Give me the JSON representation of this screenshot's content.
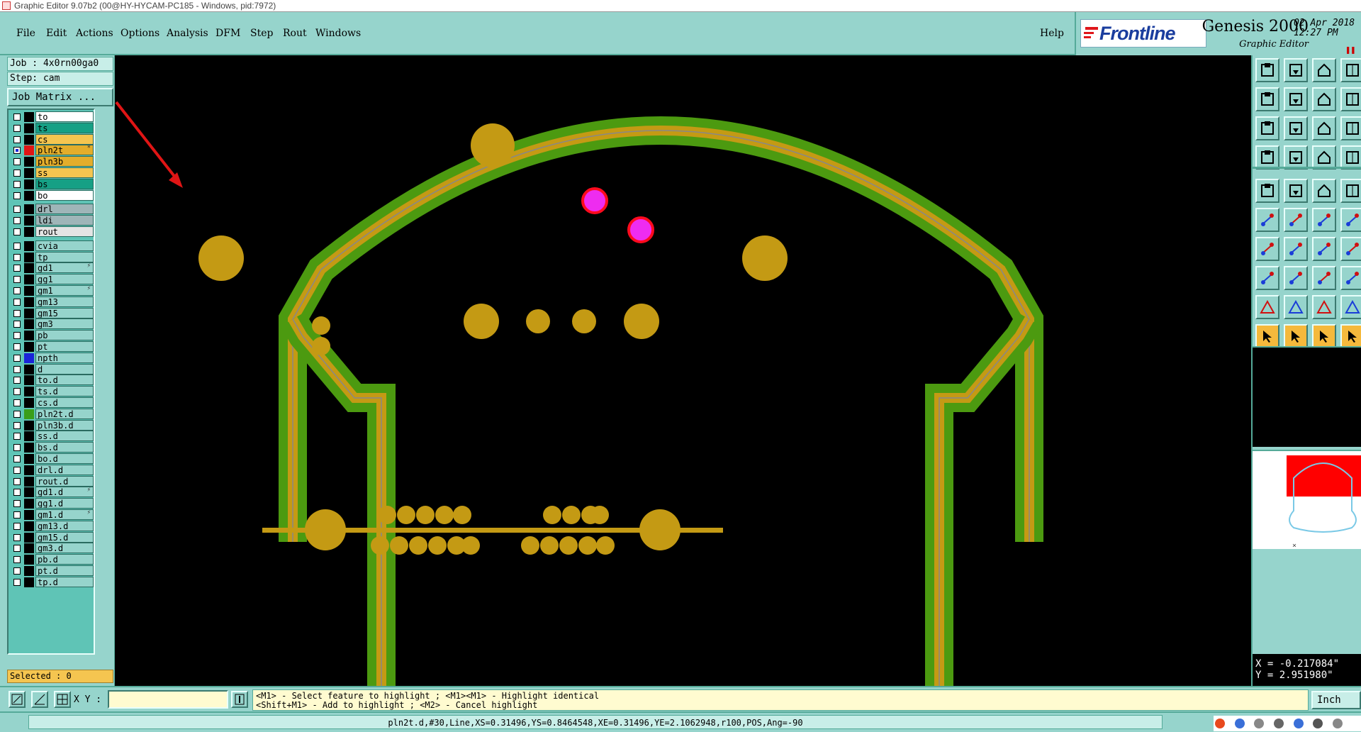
{
  "window": {
    "title": "Graphic Editor 9.07b2 (00@HY-HYCAM-PC185 - Windows, pid:7972)"
  },
  "menu": {
    "items": [
      "File",
      "Edit",
      "Actions",
      "Options",
      "Analysis",
      "DFM",
      "Step",
      "Rout",
      "Windows"
    ],
    "help": "Help"
  },
  "brand": {
    "logo": "Frontline",
    "product": "Genesis 2000",
    "subtitle": "Graphic Editor",
    "date": "02 Apr 2018",
    "time": "12:27 PM"
  },
  "job": {
    "job_label": "Job : 4x0rn00ga0",
    "step_label": "Step: cam",
    "matrix_button": "Job Matrix ..."
  },
  "layers": [
    {
      "name": "to",
      "bg": "#ffffff",
      "swatch": "#000000"
    },
    {
      "name": "ts",
      "bg": "#16a085",
      "swatch": "#000000"
    },
    {
      "name": "cs",
      "bg": "#f5c550",
      "swatch": "#000000"
    },
    {
      "name": "pln2t",
      "bg": "#e3ad2b",
      "swatch": "#e01515",
      "checked": true,
      "mark": "*"
    },
    {
      "name": "pln3b",
      "bg": "#e3ad2b",
      "swatch": "#000000"
    },
    {
      "name": "ss",
      "bg": "#f5c550",
      "swatch": "#000000"
    },
    {
      "name": "bs",
      "bg": "#16a085",
      "swatch": "#000000"
    },
    {
      "name": "bo",
      "bg": "#ffffff",
      "swatch": "#000000"
    },
    {
      "name": "drl",
      "bg": "#9fb5b8",
      "swatch": "#000000",
      "gap": true
    },
    {
      "name": "ldi",
      "bg": "#9fb5b8",
      "swatch": "#000000"
    },
    {
      "name": "rout",
      "bg": "#e4e4e4",
      "swatch": "#000000"
    },
    {
      "name": "cvia",
      "bg": "#96d4cc",
      "swatch": "#000000",
      "gap": true
    },
    {
      "name": "tp",
      "bg": "#96d4cc",
      "swatch": "#000000"
    },
    {
      "name": "gd1",
      "bg": "#96d4cc",
      "swatch": "#000000",
      "mark": "⚡"
    },
    {
      "name": "gg1",
      "bg": "#96d4cc",
      "swatch": "#000000"
    },
    {
      "name": "gm1",
      "bg": "#96d4cc",
      "swatch": "#000000",
      "mark": "⚡"
    },
    {
      "name": "gm13",
      "bg": "#96d4cc",
      "swatch": "#000000"
    },
    {
      "name": "gm15",
      "bg": "#96d4cc",
      "swatch": "#000000"
    },
    {
      "name": "gm3",
      "bg": "#96d4cc",
      "swatch": "#000000"
    },
    {
      "name": "pb",
      "bg": "#96d4cc",
      "swatch": "#000000"
    },
    {
      "name": "pt",
      "bg": "#96d4cc",
      "swatch": "#000000"
    },
    {
      "name": "npth",
      "bg": "#96d4cc",
      "swatch": "#1a24d8"
    },
    {
      "name": "d",
      "bg": "#96d4cc",
      "swatch": "#000000"
    },
    {
      "name": "to.d",
      "bg": "#96d4cc",
      "swatch": "#000000"
    },
    {
      "name": "ts.d",
      "bg": "#96d4cc",
      "swatch": "#000000"
    },
    {
      "name": "cs.d",
      "bg": "#96d4cc",
      "swatch": "#000000"
    },
    {
      "name": "pln2t.d",
      "bg": "#96d4cc",
      "swatch": "#3a9e1a"
    },
    {
      "name": "pln3b.d",
      "bg": "#96d4cc",
      "swatch": "#000000"
    },
    {
      "name": "ss.d",
      "bg": "#96d4cc",
      "swatch": "#000000"
    },
    {
      "name": "bs.d",
      "bg": "#96d4cc",
      "swatch": "#000000"
    },
    {
      "name": "bo.d",
      "bg": "#96d4cc",
      "swatch": "#000000"
    },
    {
      "name": "drl.d",
      "bg": "#96d4cc",
      "swatch": "#000000"
    },
    {
      "name": "rout.d",
      "bg": "#96d4cc",
      "swatch": "#000000"
    },
    {
      "name": "gd1.d",
      "bg": "#96d4cc",
      "swatch": "#000000",
      "mark": "⚡"
    },
    {
      "name": "gg1.d",
      "bg": "#96d4cc",
      "swatch": "#000000"
    },
    {
      "name": "gm1.d",
      "bg": "#96d4cc",
      "swatch": "#000000",
      "mark": "⚡"
    },
    {
      "name": "gm13.d",
      "bg": "#96d4cc",
      "swatch": "#000000"
    },
    {
      "name": "gm15.d",
      "bg": "#96d4cc",
      "swatch": "#000000"
    },
    {
      "name": "gm3.d",
      "bg": "#96d4cc",
      "swatch": "#000000"
    },
    {
      "name": "pb.d",
      "bg": "#96d4cc",
      "swatch": "#000000"
    },
    {
      "name": "pt.d",
      "bg": "#96d4cc",
      "swatch": "#000000"
    },
    {
      "name": "tp.d",
      "bg": "#96d4cc",
      "swatch": "#000000"
    }
  ],
  "selected": "Selected : 0",
  "input": {
    "xy_label": "X Y :",
    "value": ""
  },
  "messages": {
    "line1": "<M1> - Select feature to highlight ; <M1><M1> - Highlight identical",
    "line2": "<Shift+M1> - Add to highlight ; <M2> - Cancel highlight"
  },
  "units": "Inch",
  "coordinates": {
    "x": "X = -0.217084\"",
    "y": "Y = 2.951980\""
  },
  "status": "pln2t.d,#30,Line,XS=0.31496,YS=0.8464548,XE=0.31496,YE=2.1062948,r100,POS,Ang=-90",
  "colors": {
    "panel": "#96d4cc",
    "pad_gold": "#c49a14",
    "outline_green": "#4c9a10",
    "highlight_magenta": "#ee2cf0",
    "highlight_red": "#ff0a1e"
  },
  "toolbar_icons": [
    "home-top-icon",
    "home-bottom-icon",
    "house-icon",
    "window-icon",
    "pan-left-icon",
    "pan-right-icon",
    "ratio-icon",
    "split-icon",
    "zoom-fit-icon",
    "zoom-center-icon",
    "one-to-one-icon",
    "help-icon",
    "snap-icon",
    "grid-icon",
    "layer-compare-icon",
    "layer-stack-icon",
    "select-icon",
    "polygon-icon",
    "measure-icon",
    "pad-icon",
    "connect-icon",
    "cross-icon",
    "line-point-icon",
    "slash-icon",
    "angle-icon",
    "diagonal-icon",
    "arc-icon",
    "text-icon",
    "rect-point-icon",
    "minus-icon",
    "move-icon",
    "link-icon",
    "triangle-icon",
    "tri-a-icon",
    "tri-a-blue-icon",
    "tri-a-red-icon",
    "arrow-cursor-icon",
    "arrow-box-icon",
    "arrow-rotate-icon",
    "arrow-grid-icon"
  ]
}
